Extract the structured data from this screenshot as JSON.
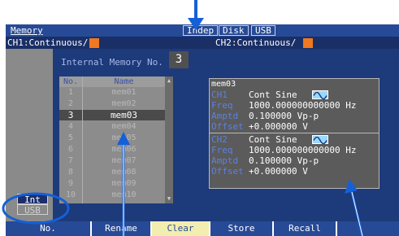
{
  "header": {
    "title": "Memory",
    "indep": "Indep",
    "disk": "Disk",
    "usb": "USB",
    "ch1": "CH1:Continuous/",
    "ch2": "CH2:Continuous/"
  },
  "memory": {
    "title": "Internal Memory No.",
    "number": "3",
    "columns": {
      "no": "No.",
      "name": "Name"
    },
    "rows": [
      {
        "no": "1",
        "name": "mem01"
      },
      {
        "no": "2",
        "name": "mem02"
      },
      {
        "no": "3",
        "name": "mem03"
      },
      {
        "no": "4",
        "name": "mem04"
      },
      {
        "no": "5",
        "name": "mem05"
      },
      {
        "no": "6",
        "name": "mem06"
      },
      {
        "no": "7",
        "name": "mem07"
      },
      {
        "no": "8",
        "name": "mem08"
      },
      {
        "no": "9",
        "name": "mem09"
      },
      {
        "no": "10",
        "name": "mem10"
      }
    ],
    "selected_index": 2
  },
  "detail": {
    "name": "mem03",
    "ch1": {
      "channel": "CH1",
      "waveform": "Cont Sine",
      "freq_label": "Freq",
      "freq": "1000.000000000000 Hz",
      "amptd_label": "Amptd",
      "amptd": "0.100000 Vp-p",
      "offset_label": "Offset",
      "offset": "+0.000000 V"
    },
    "ch2": {
      "channel": "CH2",
      "waveform": "Cont Sine",
      "freq_label": "Freq",
      "freq": "1000.000000000000 Hz",
      "amptd_label": "Amptd",
      "amptd": "0.100000 Vp-p",
      "offset_label": "Offset",
      "offset": "+0.000000 V"
    }
  },
  "media": {
    "int": "Int",
    "usb": "USB"
  },
  "softkeys": {
    "no": "No.",
    "rename": "Rename",
    "clear": "Clear",
    "store": "Store",
    "recall": "Recall"
  },
  "colors": {
    "screen_bg": "#1d3a7a",
    "accent_orange": "#f07820",
    "annotation_blue": "#1460d8",
    "clear_key": "#f2eeb0"
  }
}
